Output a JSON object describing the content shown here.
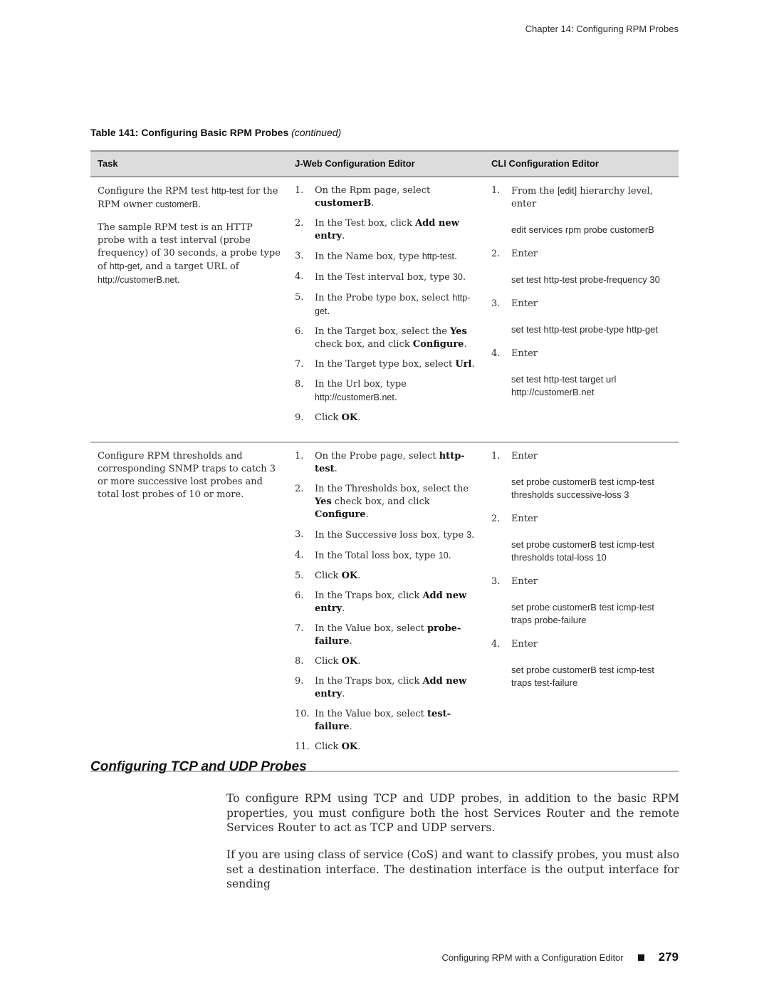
{
  "running_header": "Chapter 14: Configuring RPM Probes",
  "table": {
    "caption": "Table 141: Configuring Basic RPM Probes",
    "caption_suffix": "(continued)",
    "headers": [
      "Task",
      "J-Web Configuration Editor",
      "CLI Configuration Editor"
    ],
    "rows": [
      {
        "task": [
          [
            {
              "t": "Configure the RPM test "
            },
            {
              "t": "http-test",
              "code": true
            },
            {
              "t": " for the RPM owner "
            },
            {
              "t": "customerB",
              "code": true
            },
            {
              "t": "."
            }
          ],
          [
            {
              "t": "The sample RPM test is an HTTP probe with a test interval (probe frequency) of 30 seconds, a probe type of "
            },
            {
              "t": "http-get",
              "code": true
            },
            {
              "t": ", and a target URL of "
            },
            {
              "t": "http://customerB.net",
              "code": true
            },
            {
              "t": "."
            }
          ]
        ],
        "jweb_steps": [
          {
            "num": "1.",
            "parts": [
              {
                "t": "On the Rpm page, select "
              },
              {
                "t": "customerB",
                "bold": true
              },
              {
                "t": "."
              }
            ]
          },
          {
            "num": "2.",
            "parts": [
              {
                "t": "In the Test box, click "
              },
              {
                "t": "Add new entry",
                "bold": true
              },
              {
                "t": "."
              }
            ]
          },
          {
            "num": "3.",
            "parts": [
              {
                "t": "In the Name box, type "
              },
              {
                "t": "http-test",
                "code": true
              },
              {
                "t": "."
              }
            ]
          },
          {
            "num": "4.",
            "parts": [
              {
                "t": "In the Test interval box, type "
              },
              {
                "t": "30",
                "code": true
              },
              {
                "t": "."
              }
            ]
          },
          {
            "num": "5.",
            "parts": [
              {
                "t": "In the Probe type box, select "
              },
              {
                "t": "http-get",
                "code": true
              },
              {
                "t": "."
              }
            ]
          },
          {
            "num": "6.",
            "parts": [
              {
                "t": "In the Target box, select the "
              },
              {
                "t": "Yes",
                "bold": true
              },
              {
                "t": " check box, and click "
              },
              {
                "t": "Configure",
                "bold": true
              },
              {
                "t": "."
              }
            ]
          },
          {
            "num": "7.",
            "parts": [
              {
                "t": "In the Target type box, select "
              },
              {
                "t": "Url",
                "bold": true
              },
              {
                "t": "."
              }
            ]
          },
          {
            "num": "8.",
            "parts": [
              {
                "t": "In the Url box, type "
              },
              {
                "t": "http://customerB.net",
                "code": true
              },
              {
                "t": "."
              }
            ]
          },
          {
            "num": "9.",
            "parts": [
              {
                "t": "Click "
              },
              {
                "t": "OK",
                "bold": true
              },
              {
                "t": "."
              }
            ]
          }
        ],
        "cli_steps": [
          {
            "num": "1.",
            "parts": [
              {
                "t": "From the "
              },
              {
                "t": "[edit]",
                "code": true
              },
              {
                "t": " hierarchy level, enter"
              }
            ],
            "command": "edit services rpm probe customerB"
          },
          {
            "num": "2.",
            "parts": [
              {
                "t": "Enter"
              }
            ],
            "command": "set test http-test probe-frequency 30"
          },
          {
            "num": "3.",
            "parts": [
              {
                "t": "Enter"
              }
            ],
            "command": "set test http-test probe-type http-get"
          },
          {
            "num": "4.",
            "parts": [
              {
                "t": "Enter"
              }
            ],
            "command": "set test http-test target url http://customerB.net"
          }
        ]
      },
      {
        "task": [
          [
            {
              "t": "Configure RPM thresholds and corresponding SNMP traps to catch 3 or more successive lost probes and total lost probes of 10 or more."
            }
          ]
        ],
        "jweb_steps": [
          {
            "num": "1.",
            "parts": [
              {
                "t": "On the Probe page, select "
              },
              {
                "t": "http-test",
                "bold": true
              },
              {
                "t": "."
              }
            ]
          },
          {
            "num": "2.",
            "parts": [
              {
                "t": "In the Thresholds box, select the "
              },
              {
                "t": "Yes",
                "bold": true
              },
              {
                "t": " check box, and click "
              },
              {
                "t": "Configure",
                "bold": true
              },
              {
                "t": "."
              }
            ]
          },
          {
            "num": "3.",
            "parts": [
              {
                "t": "In the Successive loss box, type "
              },
              {
                "t": "3",
                "code": true
              },
              {
                "t": "."
              }
            ]
          },
          {
            "num": "4.",
            "parts": [
              {
                "t": "In the Total loss box, type "
              },
              {
                "t": "10",
                "code": true
              },
              {
                "t": "."
              }
            ]
          },
          {
            "num": "5.",
            "parts": [
              {
                "t": "Click "
              },
              {
                "t": "OK",
                "bold": true
              },
              {
                "t": "."
              }
            ]
          },
          {
            "num": "6.",
            "parts": [
              {
                "t": "In the Traps box, click "
              },
              {
                "t": "Add new entry",
                "bold": true
              },
              {
                "t": "."
              }
            ]
          },
          {
            "num": "7.",
            "parts": [
              {
                "t": "In the Value box, select "
              },
              {
                "t": "probe-failure",
                "bold": true
              },
              {
                "t": "."
              }
            ]
          },
          {
            "num": "8.",
            "parts": [
              {
                "t": "Click "
              },
              {
                "t": "OK",
                "bold": true
              },
              {
                "t": "."
              }
            ]
          },
          {
            "num": "9.",
            "parts": [
              {
                "t": "In the Traps box, click "
              },
              {
                "t": "Add new entry",
                "bold": true
              },
              {
                "t": "."
              }
            ]
          },
          {
            "num": "10.",
            "parts": [
              {
                "t": "In the Value box, select "
              },
              {
                "t": "test-failure",
                "bold": true
              },
              {
                "t": "."
              }
            ]
          },
          {
            "num": "11.",
            "parts": [
              {
                "t": "Click "
              },
              {
                "t": "OK",
                "bold": true
              },
              {
                "t": "."
              }
            ]
          }
        ],
        "cli_steps": [
          {
            "num": "1.",
            "parts": [
              {
                "t": "Enter"
              }
            ],
            "command": "set probe customerB test icmp-test thresholds successive-loss 3"
          },
          {
            "num": "2.",
            "parts": [
              {
                "t": "Enter"
              }
            ],
            "command": "set probe customerB test icmp-test thresholds total-loss 10"
          },
          {
            "num": "3.",
            "parts": [
              {
                "t": "Enter"
              }
            ],
            "command": "set probe customerB test icmp-test traps probe-failure"
          },
          {
            "num": "4.",
            "parts": [
              {
                "t": "Enter"
              }
            ],
            "command": "set probe customerB test icmp-test traps test-failure"
          }
        ]
      }
    ]
  },
  "section": {
    "heading": "Configuring TCP and UDP Probes",
    "paragraphs": [
      "To configure RPM using TCP and UDP probes, in addition to the basic RPM properties, you must configure both the host Services Router and the remote Services Router to act as TCP and UDP servers.",
      "If you are using class of service (CoS) and want to classify probes, you must also set a destination interface. The destination interface is the output interface for sending"
    ]
  },
  "footer": {
    "title": "Configuring RPM with a Configuration Editor",
    "page_number": "279"
  }
}
